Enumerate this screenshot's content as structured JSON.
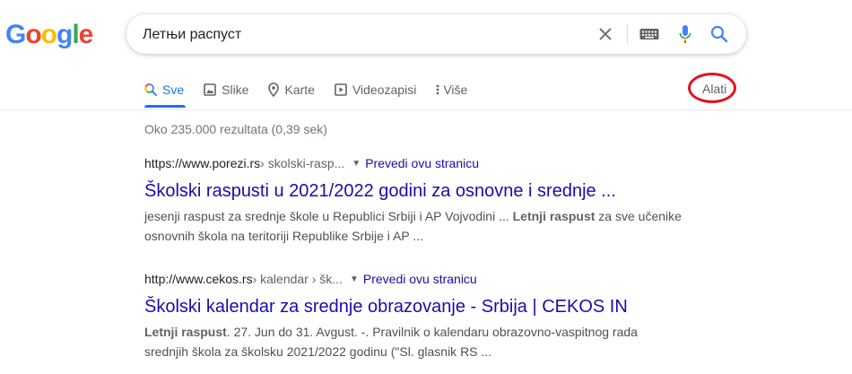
{
  "logo": "Google",
  "search": {
    "query": "Летњи распуст"
  },
  "tabs": [
    {
      "label": "Sve",
      "icon": "search-icon"
    },
    {
      "label": "Slike",
      "icon": "image-icon"
    },
    {
      "label": "Karte",
      "icon": "map-pin-icon"
    },
    {
      "label": "Videozapisi",
      "icon": "video-icon"
    },
    {
      "label": "Više",
      "icon": "more-vert-icon"
    }
  ],
  "tools_label": "Alati",
  "stats": "Oko 235.000 rezultata (0,39 sek)",
  "results": [
    {
      "site": "https://www.porezi.rs",
      "path": " › skolski-rasp...",
      "translate": "Prevedi ovu stranicu",
      "title": "Školski raspusti u 2021/2022 godini za osnovne i srednje ...",
      "s1a": "jesenji raspust za srednje škole u Republici Srbiji i AP Vojvodini ... ",
      "s1b": "Letnji raspust",
      "s1c": " za sve učenike",
      "s2": "osnovnih škola na teritoriji Republike Srbije i AP ..."
    },
    {
      "site": "http://www.cekos.rs",
      "path": " › kalendar › šk...",
      "translate": "Prevedi ovu stranicu",
      "title": "Školski kalendar za srednje obrazovanje - Srbija | CEKOS IN",
      "s1a": "",
      "s1b": "Letnji raspust",
      "s1c": ". 27. Jun do 31. Avgust. -. Pravilnik o kalendaru obrazovno-vaspitnog rada",
      "s2": "srednjih škola za školsku 2021/2022 godinu (\"Sl. glasnik RS ..."
    }
  ],
  "colors": {
    "blue": "#4285f4",
    "red": "#ea4335",
    "yellow": "#fbbc05",
    "green": "#34a853",
    "link": "#1a0dab",
    "annotation": "#e0141e"
  }
}
